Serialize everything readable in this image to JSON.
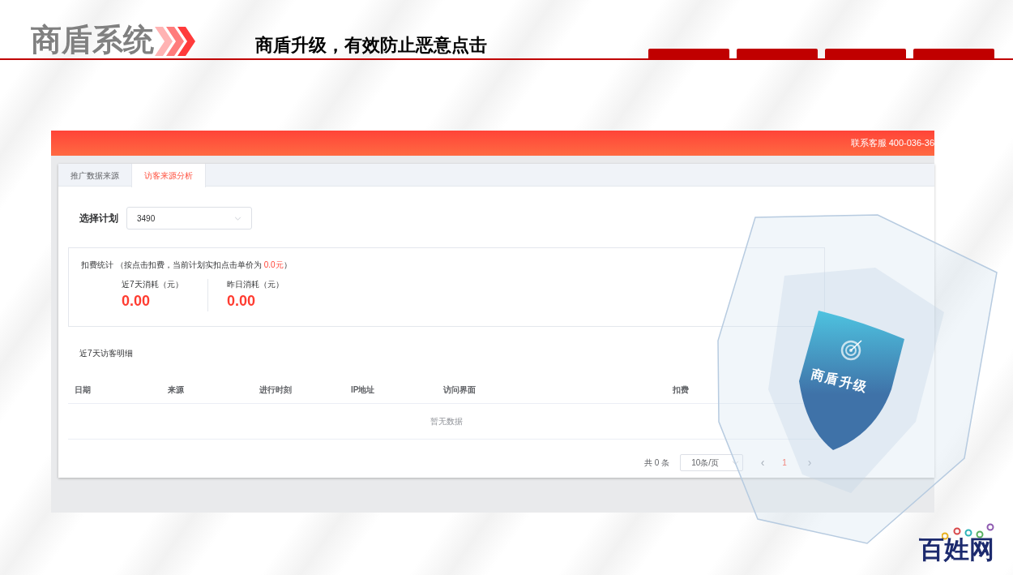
{
  "slide": {
    "title": "商盾系统",
    "subtitle": "商盾升级，有效防止恶意点击"
  },
  "app": {
    "contact": "联系客服 400-036-36",
    "tabs": [
      {
        "label": "推广数据来源",
        "selected": false
      },
      {
        "label": "访客来源分析",
        "selected": true
      }
    ],
    "plan": {
      "label": "选择计划",
      "value": "3490"
    },
    "stats": {
      "title": "扣费统计",
      "note": "（按点击扣费，当前计划实扣点击单价为 **0.0元**）",
      "items": [
        {
          "label": "近7天消耗（元）",
          "value": "0.00"
        },
        {
          "label": "昨日消耗（元）",
          "value": "0.00"
        }
      ]
    },
    "table": {
      "title": "近7天访客明细",
      "columns": [
        "日期",
        "来源",
        "进行时刻",
        "IP地址",
        "访问界面",
        "扣费"
      ],
      "empty": "暂无数据"
    },
    "pagination": {
      "total": "共 0 条",
      "page_size": "10条/页",
      "prev": "‹",
      "next": "›",
      "pages": [
        {
          "label": "1",
          "selected": true
        }
      ]
    }
  },
  "badge": {
    "text": "商盾升级"
  },
  "logo": {
    "text": "百姓网"
  }
}
